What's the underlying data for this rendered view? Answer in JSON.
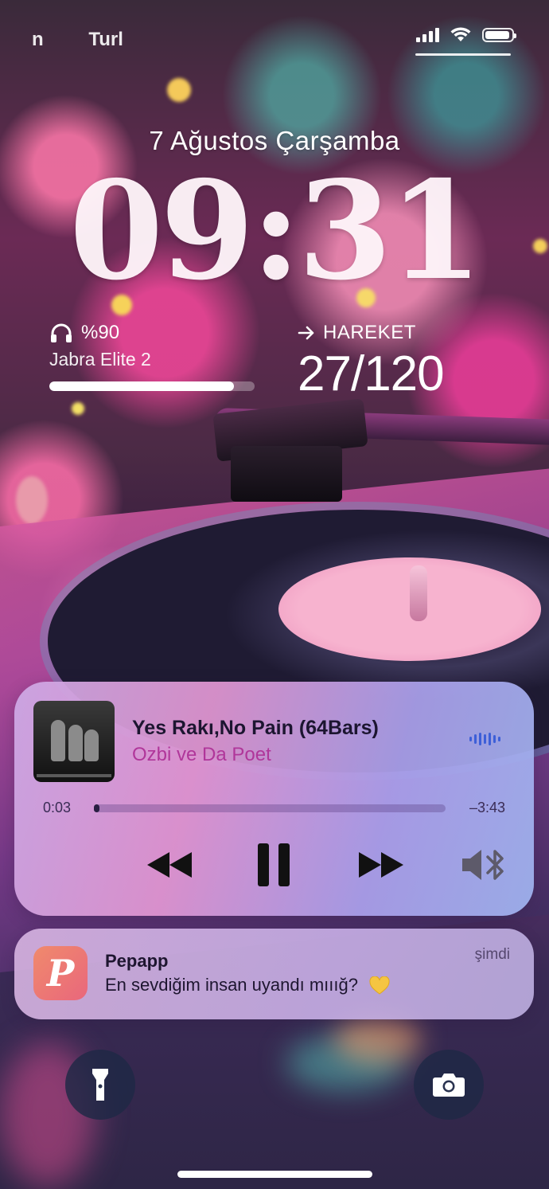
{
  "status_bar": {
    "carrier_a": "n",
    "carrier_b": "Turl",
    "signal_icon": "cellular-signal-icon",
    "wifi_icon": "wifi-icon",
    "battery_icon": "battery-icon",
    "battery_level": 0.95
  },
  "lockscreen": {
    "date": "7 Ağustos Çarşamba",
    "time": "09:31"
  },
  "widgets": {
    "headphones": {
      "icon": "headphones-icon",
      "battery": "%90",
      "device": "Jabra Elite 2",
      "battery_level": 0.9
    },
    "activity": {
      "icon": "arrow-right-icon",
      "label": "HAREKET",
      "value": "27/120"
    }
  },
  "now_playing": {
    "title": "Yes Rakı,No Pain (64Bars)",
    "artist": "Ozbi ve Da Poet",
    "elapsed": "0:03",
    "remaining": "–3:43",
    "progress": 0.014,
    "controls": {
      "back_icon": "rewind-icon",
      "pause_icon": "pause-icon",
      "forward_icon": "fast-forward-icon",
      "output_icon": "speaker-bluetooth-icon"
    },
    "colors": {
      "artist": "#b0369a",
      "waveform": "#3d5fd8"
    }
  },
  "notification": {
    "app": "Pepapp",
    "message": "En sevdiğim insan uyandı mııığ?",
    "time": "şimdi",
    "app_icon_letter": "P",
    "emoji_icon": "yellow-heart-icon",
    "accent": "#ed7874"
  },
  "quick_actions": {
    "flashlight_icon": "flashlight-icon",
    "camera_icon": "camera-icon"
  }
}
